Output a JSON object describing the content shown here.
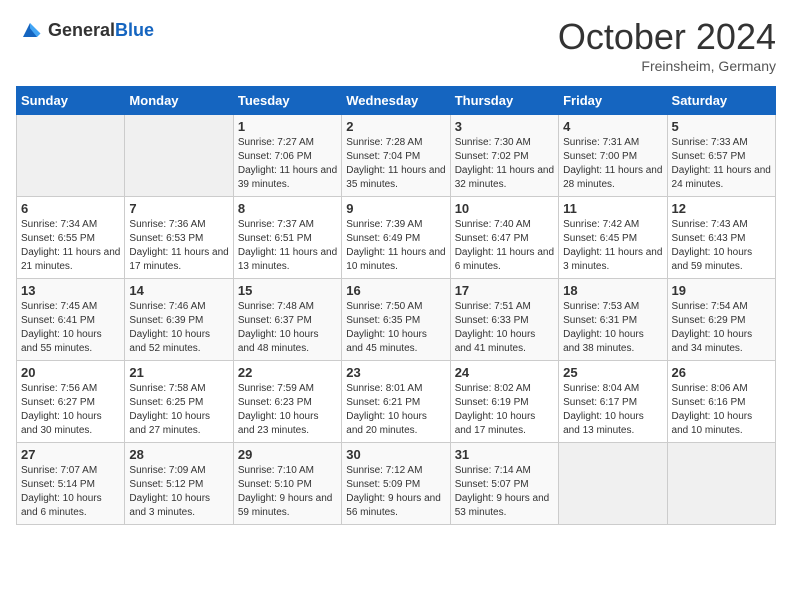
{
  "header": {
    "logo_general": "General",
    "logo_blue": "Blue",
    "title": "October 2024",
    "location": "Freinsheim, Germany"
  },
  "weekdays": [
    "Sunday",
    "Monday",
    "Tuesday",
    "Wednesday",
    "Thursday",
    "Friday",
    "Saturday"
  ],
  "weeks": [
    [
      {
        "day": "",
        "empty": true
      },
      {
        "day": "",
        "empty": true
      },
      {
        "day": "1",
        "sunrise": "Sunrise: 7:27 AM",
        "sunset": "Sunset: 7:06 PM",
        "daylight": "Daylight: 11 hours and 39 minutes."
      },
      {
        "day": "2",
        "sunrise": "Sunrise: 7:28 AM",
        "sunset": "Sunset: 7:04 PM",
        "daylight": "Daylight: 11 hours and 35 minutes."
      },
      {
        "day": "3",
        "sunrise": "Sunrise: 7:30 AM",
        "sunset": "Sunset: 7:02 PM",
        "daylight": "Daylight: 11 hours and 32 minutes."
      },
      {
        "day": "4",
        "sunrise": "Sunrise: 7:31 AM",
        "sunset": "Sunset: 7:00 PM",
        "daylight": "Daylight: 11 hours and 28 minutes."
      },
      {
        "day": "5",
        "sunrise": "Sunrise: 7:33 AM",
        "sunset": "Sunset: 6:57 PM",
        "daylight": "Daylight: 11 hours and 24 minutes."
      }
    ],
    [
      {
        "day": "6",
        "sunrise": "Sunrise: 7:34 AM",
        "sunset": "Sunset: 6:55 PM",
        "daylight": "Daylight: 11 hours and 21 minutes."
      },
      {
        "day": "7",
        "sunrise": "Sunrise: 7:36 AM",
        "sunset": "Sunset: 6:53 PM",
        "daylight": "Daylight: 11 hours and 17 minutes."
      },
      {
        "day": "8",
        "sunrise": "Sunrise: 7:37 AM",
        "sunset": "Sunset: 6:51 PM",
        "daylight": "Daylight: 11 hours and 13 minutes."
      },
      {
        "day": "9",
        "sunrise": "Sunrise: 7:39 AM",
        "sunset": "Sunset: 6:49 PM",
        "daylight": "Daylight: 11 hours and 10 minutes."
      },
      {
        "day": "10",
        "sunrise": "Sunrise: 7:40 AM",
        "sunset": "Sunset: 6:47 PM",
        "daylight": "Daylight: 11 hours and 6 minutes."
      },
      {
        "day": "11",
        "sunrise": "Sunrise: 7:42 AM",
        "sunset": "Sunset: 6:45 PM",
        "daylight": "Daylight: 11 hours and 3 minutes."
      },
      {
        "day": "12",
        "sunrise": "Sunrise: 7:43 AM",
        "sunset": "Sunset: 6:43 PM",
        "daylight": "Daylight: 10 hours and 59 minutes."
      }
    ],
    [
      {
        "day": "13",
        "sunrise": "Sunrise: 7:45 AM",
        "sunset": "Sunset: 6:41 PM",
        "daylight": "Daylight: 10 hours and 55 minutes."
      },
      {
        "day": "14",
        "sunrise": "Sunrise: 7:46 AM",
        "sunset": "Sunset: 6:39 PM",
        "daylight": "Daylight: 10 hours and 52 minutes."
      },
      {
        "day": "15",
        "sunrise": "Sunrise: 7:48 AM",
        "sunset": "Sunset: 6:37 PM",
        "daylight": "Daylight: 10 hours and 48 minutes."
      },
      {
        "day": "16",
        "sunrise": "Sunrise: 7:50 AM",
        "sunset": "Sunset: 6:35 PM",
        "daylight": "Daylight: 10 hours and 45 minutes."
      },
      {
        "day": "17",
        "sunrise": "Sunrise: 7:51 AM",
        "sunset": "Sunset: 6:33 PM",
        "daylight": "Daylight: 10 hours and 41 minutes."
      },
      {
        "day": "18",
        "sunrise": "Sunrise: 7:53 AM",
        "sunset": "Sunset: 6:31 PM",
        "daylight": "Daylight: 10 hours and 38 minutes."
      },
      {
        "day": "19",
        "sunrise": "Sunrise: 7:54 AM",
        "sunset": "Sunset: 6:29 PM",
        "daylight": "Daylight: 10 hours and 34 minutes."
      }
    ],
    [
      {
        "day": "20",
        "sunrise": "Sunrise: 7:56 AM",
        "sunset": "Sunset: 6:27 PM",
        "daylight": "Daylight: 10 hours and 30 minutes."
      },
      {
        "day": "21",
        "sunrise": "Sunrise: 7:58 AM",
        "sunset": "Sunset: 6:25 PM",
        "daylight": "Daylight: 10 hours and 27 minutes."
      },
      {
        "day": "22",
        "sunrise": "Sunrise: 7:59 AM",
        "sunset": "Sunset: 6:23 PM",
        "daylight": "Daylight: 10 hours and 23 minutes."
      },
      {
        "day": "23",
        "sunrise": "Sunrise: 8:01 AM",
        "sunset": "Sunset: 6:21 PM",
        "daylight": "Daylight: 10 hours and 20 minutes."
      },
      {
        "day": "24",
        "sunrise": "Sunrise: 8:02 AM",
        "sunset": "Sunset: 6:19 PM",
        "daylight": "Daylight: 10 hours and 17 minutes."
      },
      {
        "day": "25",
        "sunrise": "Sunrise: 8:04 AM",
        "sunset": "Sunset: 6:17 PM",
        "daylight": "Daylight: 10 hours and 13 minutes."
      },
      {
        "day": "26",
        "sunrise": "Sunrise: 8:06 AM",
        "sunset": "Sunset: 6:16 PM",
        "daylight": "Daylight: 10 hours and 10 minutes."
      }
    ],
    [
      {
        "day": "27",
        "sunrise": "Sunrise: 7:07 AM",
        "sunset": "Sunset: 5:14 PM",
        "daylight": "Daylight: 10 hours and 6 minutes."
      },
      {
        "day": "28",
        "sunrise": "Sunrise: 7:09 AM",
        "sunset": "Sunset: 5:12 PM",
        "daylight": "Daylight: 10 hours and 3 minutes."
      },
      {
        "day": "29",
        "sunrise": "Sunrise: 7:10 AM",
        "sunset": "Sunset: 5:10 PM",
        "daylight": "Daylight: 9 hours and 59 minutes."
      },
      {
        "day": "30",
        "sunrise": "Sunrise: 7:12 AM",
        "sunset": "Sunset: 5:09 PM",
        "daylight": "Daylight: 9 hours and 56 minutes."
      },
      {
        "day": "31",
        "sunrise": "Sunrise: 7:14 AM",
        "sunset": "Sunset: 5:07 PM",
        "daylight": "Daylight: 9 hours and 53 minutes."
      },
      {
        "day": "",
        "empty": true
      },
      {
        "day": "",
        "empty": true
      }
    ]
  ]
}
